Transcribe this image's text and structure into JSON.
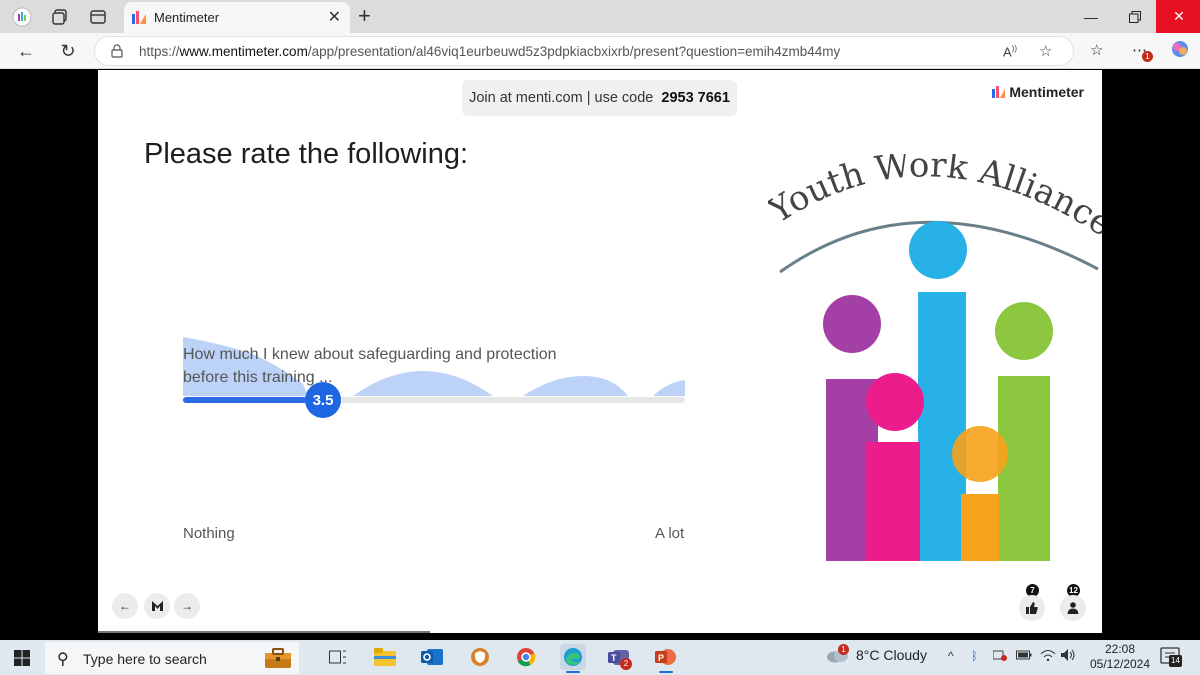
{
  "browser": {
    "tab_title": "Mentimeter",
    "url_prefix": "https://",
    "url_domain": "www.mentimeter.com",
    "url_path": "/app/presentation/al46viq1eurbeuwd5z3pdpkiacbxixrb/present?question=emih4zmb44my",
    "extensions_badge": "1"
  },
  "slide": {
    "join_text": "Join at menti.com | use code",
    "join_code": "2953 7661",
    "brand": "Mentimeter",
    "question": "Please rate the following:",
    "item": {
      "label": "How much I knew about safeguarding and protection before this training ...",
      "value": "3.5",
      "value_num": 3.5,
      "scale_min": 1,
      "scale_max": 5
    },
    "min_label": "Nothing",
    "max_label": "A lot",
    "logo_text": "Youth Work Alliance",
    "reactions": {
      "likes": "7",
      "participants": "12"
    }
  },
  "taskbar": {
    "search_placeholder": "Type here to search",
    "teams_badge": "2",
    "weather_badge": "1",
    "weather": "8°C  Cloudy",
    "time": "22:08",
    "date": "05/12/2024",
    "notifications": "14"
  },
  "colors": {
    "accent": "#1f66e3",
    "distribution": "#bcd3f7",
    "logo_purple": "#a43fa6",
    "logo_blue": "#27b1e6",
    "logo_green": "#8dc63f",
    "logo_pink": "#ec1c8c",
    "logo_orange": "#f7a21b"
  }
}
